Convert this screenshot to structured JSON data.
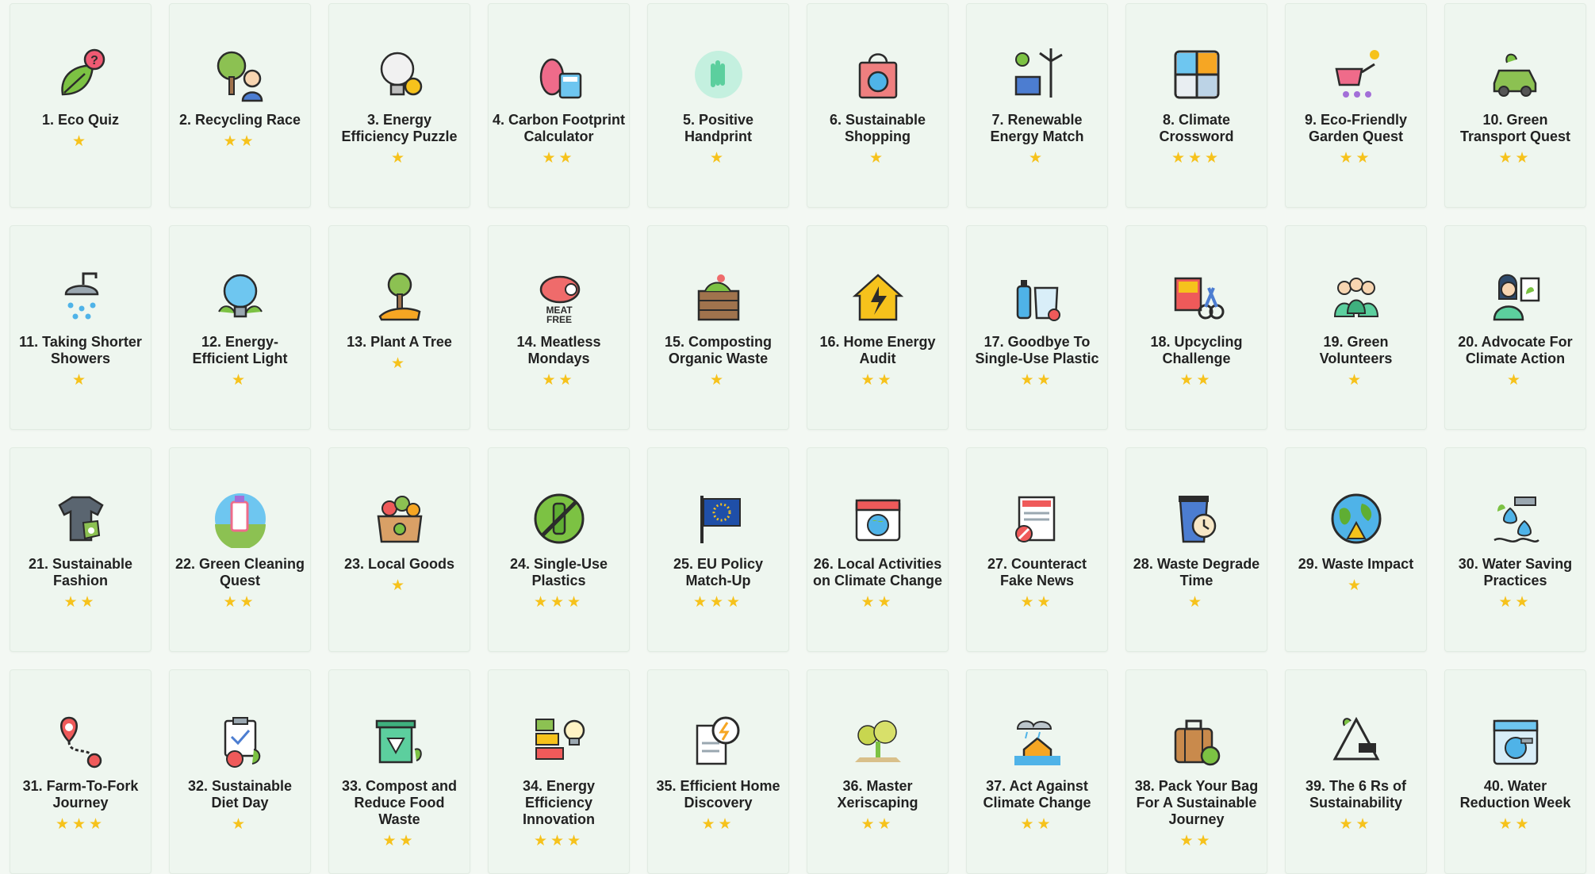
{
  "colors": {
    "star": "#f6c21c",
    "card_bg": "#eef6ef",
    "page_bg": "#f3f8f3"
  },
  "cards": [
    {
      "title": "1. Eco Quiz",
      "stars": 1,
      "icon": "leaf-question-icon"
    },
    {
      "title": "2. Recycling Race",
      "stars": 2,
      "icon": "recycle-tree-person-icon"
    },
    {
      "title": "3. Energy Efficiency Puzzle",
      "stars": 1,
      "icon": "lightbulb-puzzle-icon"
    },
    {
      "title": "4. Carbon Footprint Calculator",
      "stars": 2,
      "icon": "footprint-calculator-icon"
    },
    {
      "title": "5. Positive Handprint",
      "stars": 1,
      "icon": "handprint-icon"
    },
    {
      "title": "6. Sustainable Shopping",
      "stars": 1,
      "icon": "shopping-bag-globe-icon"
    },
    {
      "title": "7. Renewable Energy Match",
      "stars": 1,
      "icon": "solar-wind-icon"
    },
    {
      "title": "8. Climate Crossword",
      "stars": 3,
      "icon": "weather-grid-icon"
    },
    {
      "title": "9. Eco-Friendly Garden Quest",
      "stars": 2,
      "icon": "watering-can-icon"
    },
    {
      "title": "10. Green Transport Quest",
      "stars": 2,
      "icon": "electric-car-icon"
    },
    {
      "title": "11. Taking Shorter Showers",
      "stars": 1,
      "icon": "shower-icon"
    },
    {
      "title": "12. Energy-Efficient Light",
      "stars": 1,
      "icon": "eco-bulb-icon"
    },
    {
      "title": "13. Plant A Tree",
      "stars": 1,
      "icon": "tree-hand-icon"
    },
    {
      "title": "14. Meatless Mondays",
      "stars": 2,
      "icon": "meat-free-icon"
    },
    {
      "title": "15. Composting Organic Waste",
      "stars": 1,
      "icon": "compost-bin-icon"
    },
    {
      "title": "16. Home Energy Audit",
      "stars": 2,
      "icon": "house-lightning-icon"
    },
    {
      "title": "17. Goodbye To Single-Use Plastic",
      "stars": 2,
      "icon": "plastic-bottle-bag-icon"
    },
    {
      "title": "18. Upcycling Challenge",
      "stars": 2,
      "icon": "upcycling-tools-icon"
    },
    {
      "title": "19. Green Volunteers",
      "stars": 1,
      "icon": "volunteers-icon"
    },
    {
      "title": "20. Advocate For Climate Action",
      "stars": 1,
      "icon": "advocate-sign-icon"
    },
    {
      "title": "21. Sustainable Fashion",
      "stars": 2,
      "icon": "tshirt-tag-icon"
    },
    {
      "title": "22. Green Cleaning Quest",
      "stars": 2,
      "icon": "cleaning-products-icon"
    },
    {
      "title": "23. Local Goods",
      "stars": 1,
      "icon": "produce-box-icon"
    },
    {
      "title": "24. Single-Use Plastics",
      "stars": 3,
      "icon": "no-plastic-bottle-icon"
    },
    {
      "title": "25. EU Policy Match-Up",
      "stars": 3,
      "icon": "eu-flag-icon"
    },
    {
      "title": "26. Local Activities on Climate Change",
      "stars": 2,
      "icon": "calendar-globe-icon"
    },
    {
      "title": "27. Counteract Fake News",
      "stars": 2,
      "icon": "newspaper-icon"
    },
    {
      "title": "28. Waste Degrade Time",
      "stars": 1,
      "icon": "cup-clock-icon"
    },
    {
      "title": "29. Waste Impact",
      "stars": 1,
      "icon": "globe-warning-icon"
    },
    {
      "title": "30. Water Saving Practices",
      "stars": 2,
      "icon": "water-tap-drops-icon"
    },
    {
      "title": "31. Farm-To-Fork Journey",
      "stars": 3,
      "icon": "route-pin-icon"
    },
    {
      "title": "32. Sustainable Diet Day",
      "stars": 1,
      "icon": "diet-clipboard-icon"
    },
    {
      "title": "33. Compost and Reduce Food Waste",
      "stars": 2,
      "icon": "food-bin-icon"
    },
    {
      "title": "34. Energy Efficiency Innovation",
      "stars": 3,
      "icon": "energy-label-icon"
    },
    {
      "title": "35. Efficient Home Discovery",
      "stars": 2,
      "icon": "document-magnifier-icon"
    },
    {
      "title": "36. Master Xeriscaping",
      "stars": 2,
      "icon": "desert-plants-icon"
    },
    {
      "title": "37. Act Against Climate Change",
      "stars": 2,
      "icon": "flood-house-icon"
    },
    {
      "title": "38. Pack Your Bag For A Sustainable Journey",
      "stars": 2,
      "icon": "suitcase-leaf-icon"
    },
    {
      "title": "39. The 6 Rs of Sustainability",
      "stars": 2,
      "icon": "recycle-triangle-icon"
    },
    {
      "title": "40. Water Reduction Week",
      "stars": 2,
      "icon": "calendar-water-icon"
    }
  ]
}
